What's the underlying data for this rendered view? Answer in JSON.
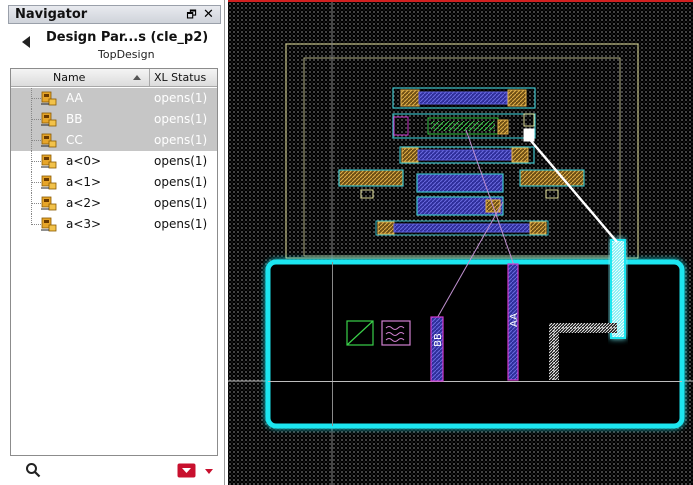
{
  "navigator": {
    "title": "Navigator",
    "float_glyph": "🗗",
    "close_glyph": "✕",
    "design_title": "Design Par...s (cle_p2)",
    "design_subtitle": "TopDesign",
    "columns": {
      "name": "Name",
      "status": "XL Status"
    },
    "rows": [
      {
        "name": "AA",
        "status": "opens(1)",
        "selected": true
      },
      {
        "name": "BB",
        "status": "opens(1)",
        "selected": true
      },
      {
        "name": "CC",
        "status": "opens(1)",
        "selected": true
      },
      {
        "name": "a<0>",
        "status": "opens(1)",
        "selected": false
      },
      {
        "name": "a<1>",
        "status": "opens(1)",
        "selected": false
      },
      {
        "name": "a<2>",
        "status": "opens(1)",
        "selected": false
      },
      {
        "name": "a<3>",
        "status": "opens(1)",
        "selected": false
      }
    ]
  },
  "canvas": {
    "labels": {
      "aa": "AA",
      "bb": "BB"
    },
    "colors": {
      "background": "#000000",
      "highlight": "#1fe6f0",
      "boundary": "#e8e6a0",
      "flight_line": "#ffffff",
      "metal": "#3a3aa8",
      "poly": "#d9a53a",
      "diffusion": "#3bc0c8"
    }
  }
}
